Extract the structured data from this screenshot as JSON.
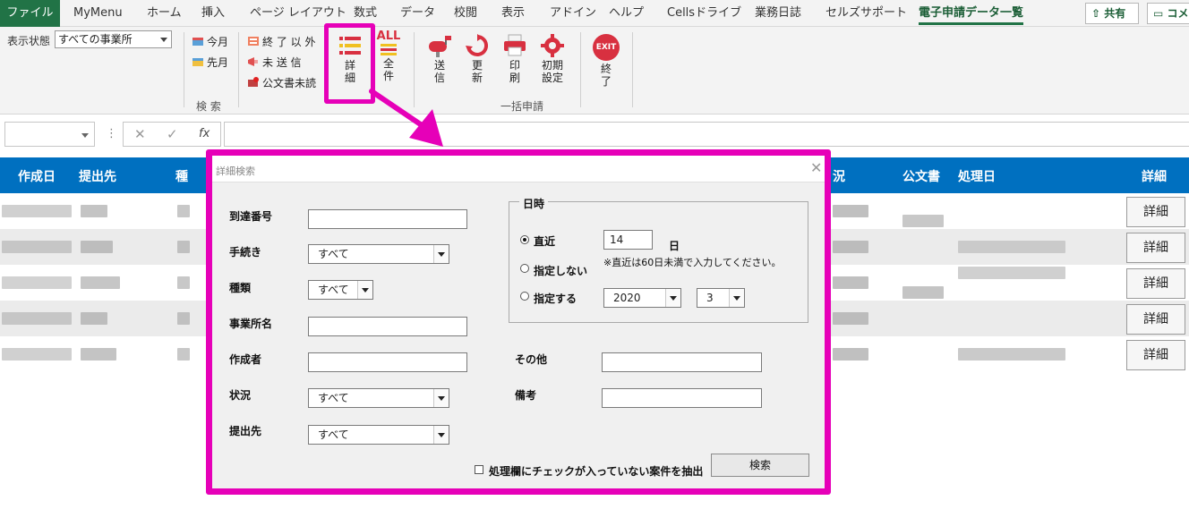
{
  "menu": {
    "file": "ファイル",
    "tabs": [
      "MyMenu",
      "ホーム",
      "挿入",
      "ページ レイアウト",
      "数式",
      "データ",
      "校閲",
      "表示",
      "アドイン",
      "ヘルプ",
      "Cellsドライブ",
      "業務日誌",
      "セルズサポート",
      "電子申請データ一覧"
    ],
    "active_tab": "電子申請データ一覧",
    "share": "共有",
    "comment": "コメント"
  },
  "ribbon": {
    "display_state_label": "表示状態",
    "display_state_value": "すべての事業所",
    "this_month": "今月",
    "last_month": "先月",
    "not_completed": "終 了 以 外",
    "unsent": "未 送 信",
    "unread_official": "公文書未読",
    "detail_l1": "詳",
    "detail_l2": "細",
    "all_top": "ALL",
    "all_l1": "全",
    "all_l2": "件",
    "send_l1": "送",
    "send_l2": "信",
    "update_l1": "更",
    "update_l2": "新",
    "print_l1": "印",
    "print_l2": "刷",
    "settings_l1": "初期",
    "settings_l2": "設定",
    "exit_badge": "EXIT",
    "exit_l1": "終",
    "exit_l2": "了",
    "group_search": "検 索",
    "group_batch": "一括申請"
  },
  "formula_bar": {
    "cancel": "✕",
    "enter": "✓",
    "fx": "fx"
  },
  "table": {
    "headers": [
      "作成日",
      "提出先",
      "種",
      "況",
      "公文書",
      "処理日",
      "詳細"
    ],
    "detail_button": "詳細",
    "row_count": 5
  },
  "dialog": {
    "title": "詳細検索",
    "close": "✕",
    "labels": {
      "arrival_no": "到達番号",
      "procedure": "手続き",
      "kind": "種類",
      "office_name": "事業所名",
      "author": "作成者",
      "status": "状況",
      "destination": "提出先",
      "other": "その他",
      "remarks": "備考"
    },
    "combo_values": {
      "procedure": "すべて",
      "kind": "すべて",
      "status": "すべて",
      "destination": "すべて"
    },
    "datetime": {
      "legend": "日時",
      "recent": "直近",
      "recent_days": "14",
      "day_unit": "日",
      "note": "※直近は60日未満で入力してください。",
      "unspecified": "指定しない",
      "specify": "指定する",
      "year": "2020",
      "month": "3",
      "selected": "recent"
    },
    "checkbox_label": "処理欄にチェックが入っていない案件を抽出",
    "search_button": "検索"
  },
  "colors": {
    "excel_green": "#217346",
    "header_blue": "#0070c0",
    "highlight_magenta": "#e600b8"
  }
}
